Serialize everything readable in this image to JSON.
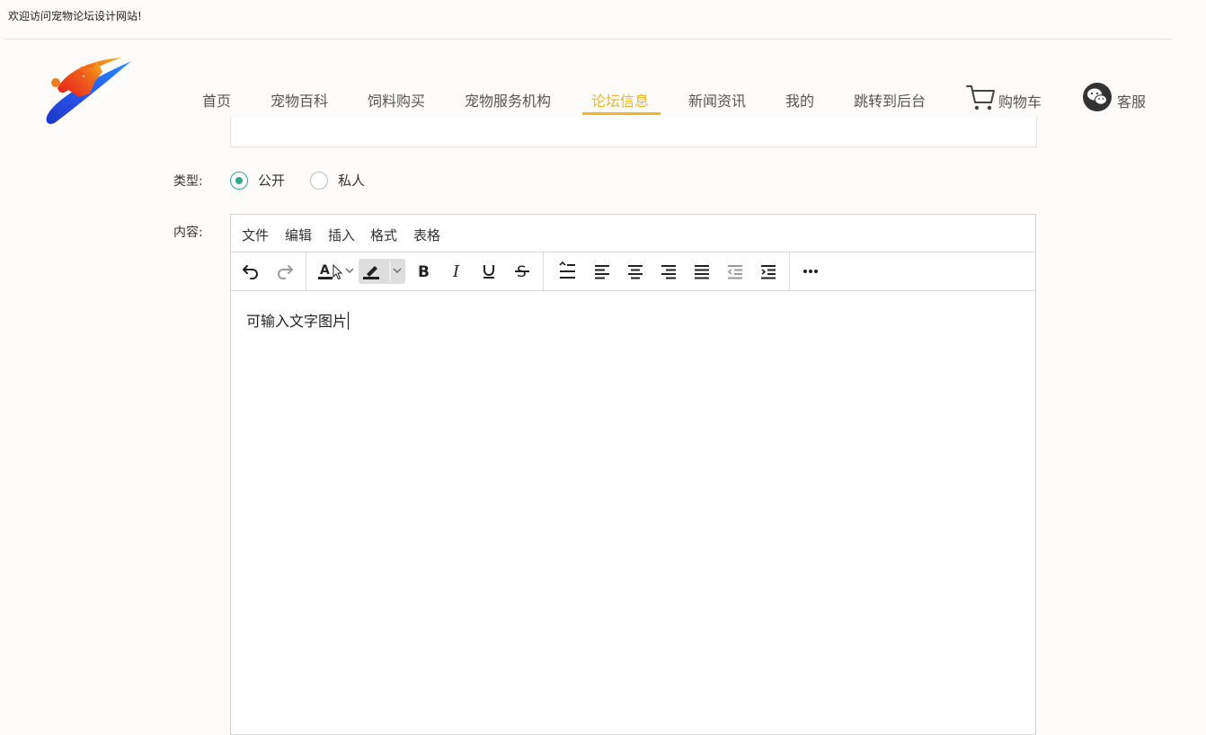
{
  "welcome_text": "欢迎访问宠物论坛设计网站!",
  "nav": {
    "items": [
      {
        "label": "首页",
        "active": false
      },
      {
        "label": "宠物百科",
        "active": false
      },
      {
        "label": "饲料购买",
        "active": false
      },
      {
        "label": "宠物服务机构",
        "active": false
      },
      {
        "label": "论坛信息",
        "active": true
      },
      {
        "label": "新闻资讯",
        "active": false
      },
      {
        "label": "我的",
        "active": false
      },
      {
        "label": "跳转到后台",
        "active": false
      }
    ],
    "cart_label": "购物车",
    "service_label": "客服",
    "accent_color": "#f3b523"
  },
  "form": {
    "type_label": "类型:",
    "type_options": [
      {
        "label": "公开",
        "checked": true
      },
      {
        "label": "私人",
        "checked": false
      }
    ],
    "content_label": "内容:"
  },
  "editor": {
    "menu": [
      "文件",
      "编辑",
      "插入",
      "格式",
      "表格"
    ],
    "toolbar_icons": [
      "undo-icon",
      "redo-icon",
      "text-color-icon",
      "highlight-color-icon",
      "bold-icon",
      "italic-icon",
      "underline-icon",
      "strikethrough-icon",
      "line-height-icon",
      "align-left-icon",
      "align-center-icon",
      "align-right-icon",
      "align-justify-icon",
      "outdent-icon",
      "indent-icon",
      "more-icon"
    ],
    "content": "可输入文字图片"
  },
  "colors": {
    "radio_checked": "#2fa98b"
  }
}
